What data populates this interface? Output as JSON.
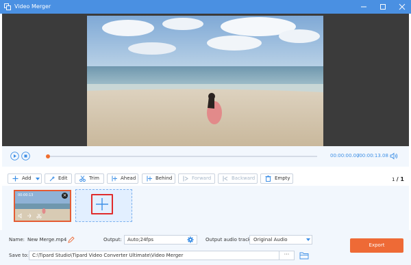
{
  "window": {
    "title": "Video Merger",
    "icons": {
      "app": "merge-icon",
      "minimize": "minimize-icon",
      "maximize": "maximize-icon",
      "close": "close-icon"
    }
  },
  "player": {
    "current_time": "00:00:00.00",
    "total_time": "/00:00:13.08",
    "progress": 0.0,
    "icons": {
      "play": "play-icon",
      "stop": "stop-icon",
      "volume": "volume-icon"
    }
  },
  "toolbar": {
    "add_label": "Add",
    "edit_label": "Edit",
    "trim_label": "Trim",
    "ahead_label": "Ahead",
    "behind_label": "Behind",
    "forward_label": "Forward",
    "backward_label": "Backward",
    "empty_label": "Empty",
    "page_current": "1",
    "page_total": "/ 1"
  },
  "clips": {
    "items": [
      {
        "name": "00:00:13",
        "icons": [
          "volume-icon",
          "effect-icon",
          "cut-icon"
        ]
      }
    ],
    "add_icon": "plus-icon"
  },
  "settings": {
    "name_label": "Name:",
    "name_value": "New Merge.mp4",
    "output_label": "Output:",
    "output_value": "Auto;24fps",
    "audio_label": "Output audio track:",
    "audio_value": "Original Audio",
    "save_label": "Save to:",
    "save_path": "C:\\Tipard Studio\\Tipard Video Converter Ultimate\\Video Merger",
    "browse_label": "···",
    "export_label": "Export"
  },
  "colors": {
    "accent": "#4a90e2",
    "export": "#ee6a36",
    "highlight": "#e02b2b",
    "time": "#3d8fe6"
  }
}
